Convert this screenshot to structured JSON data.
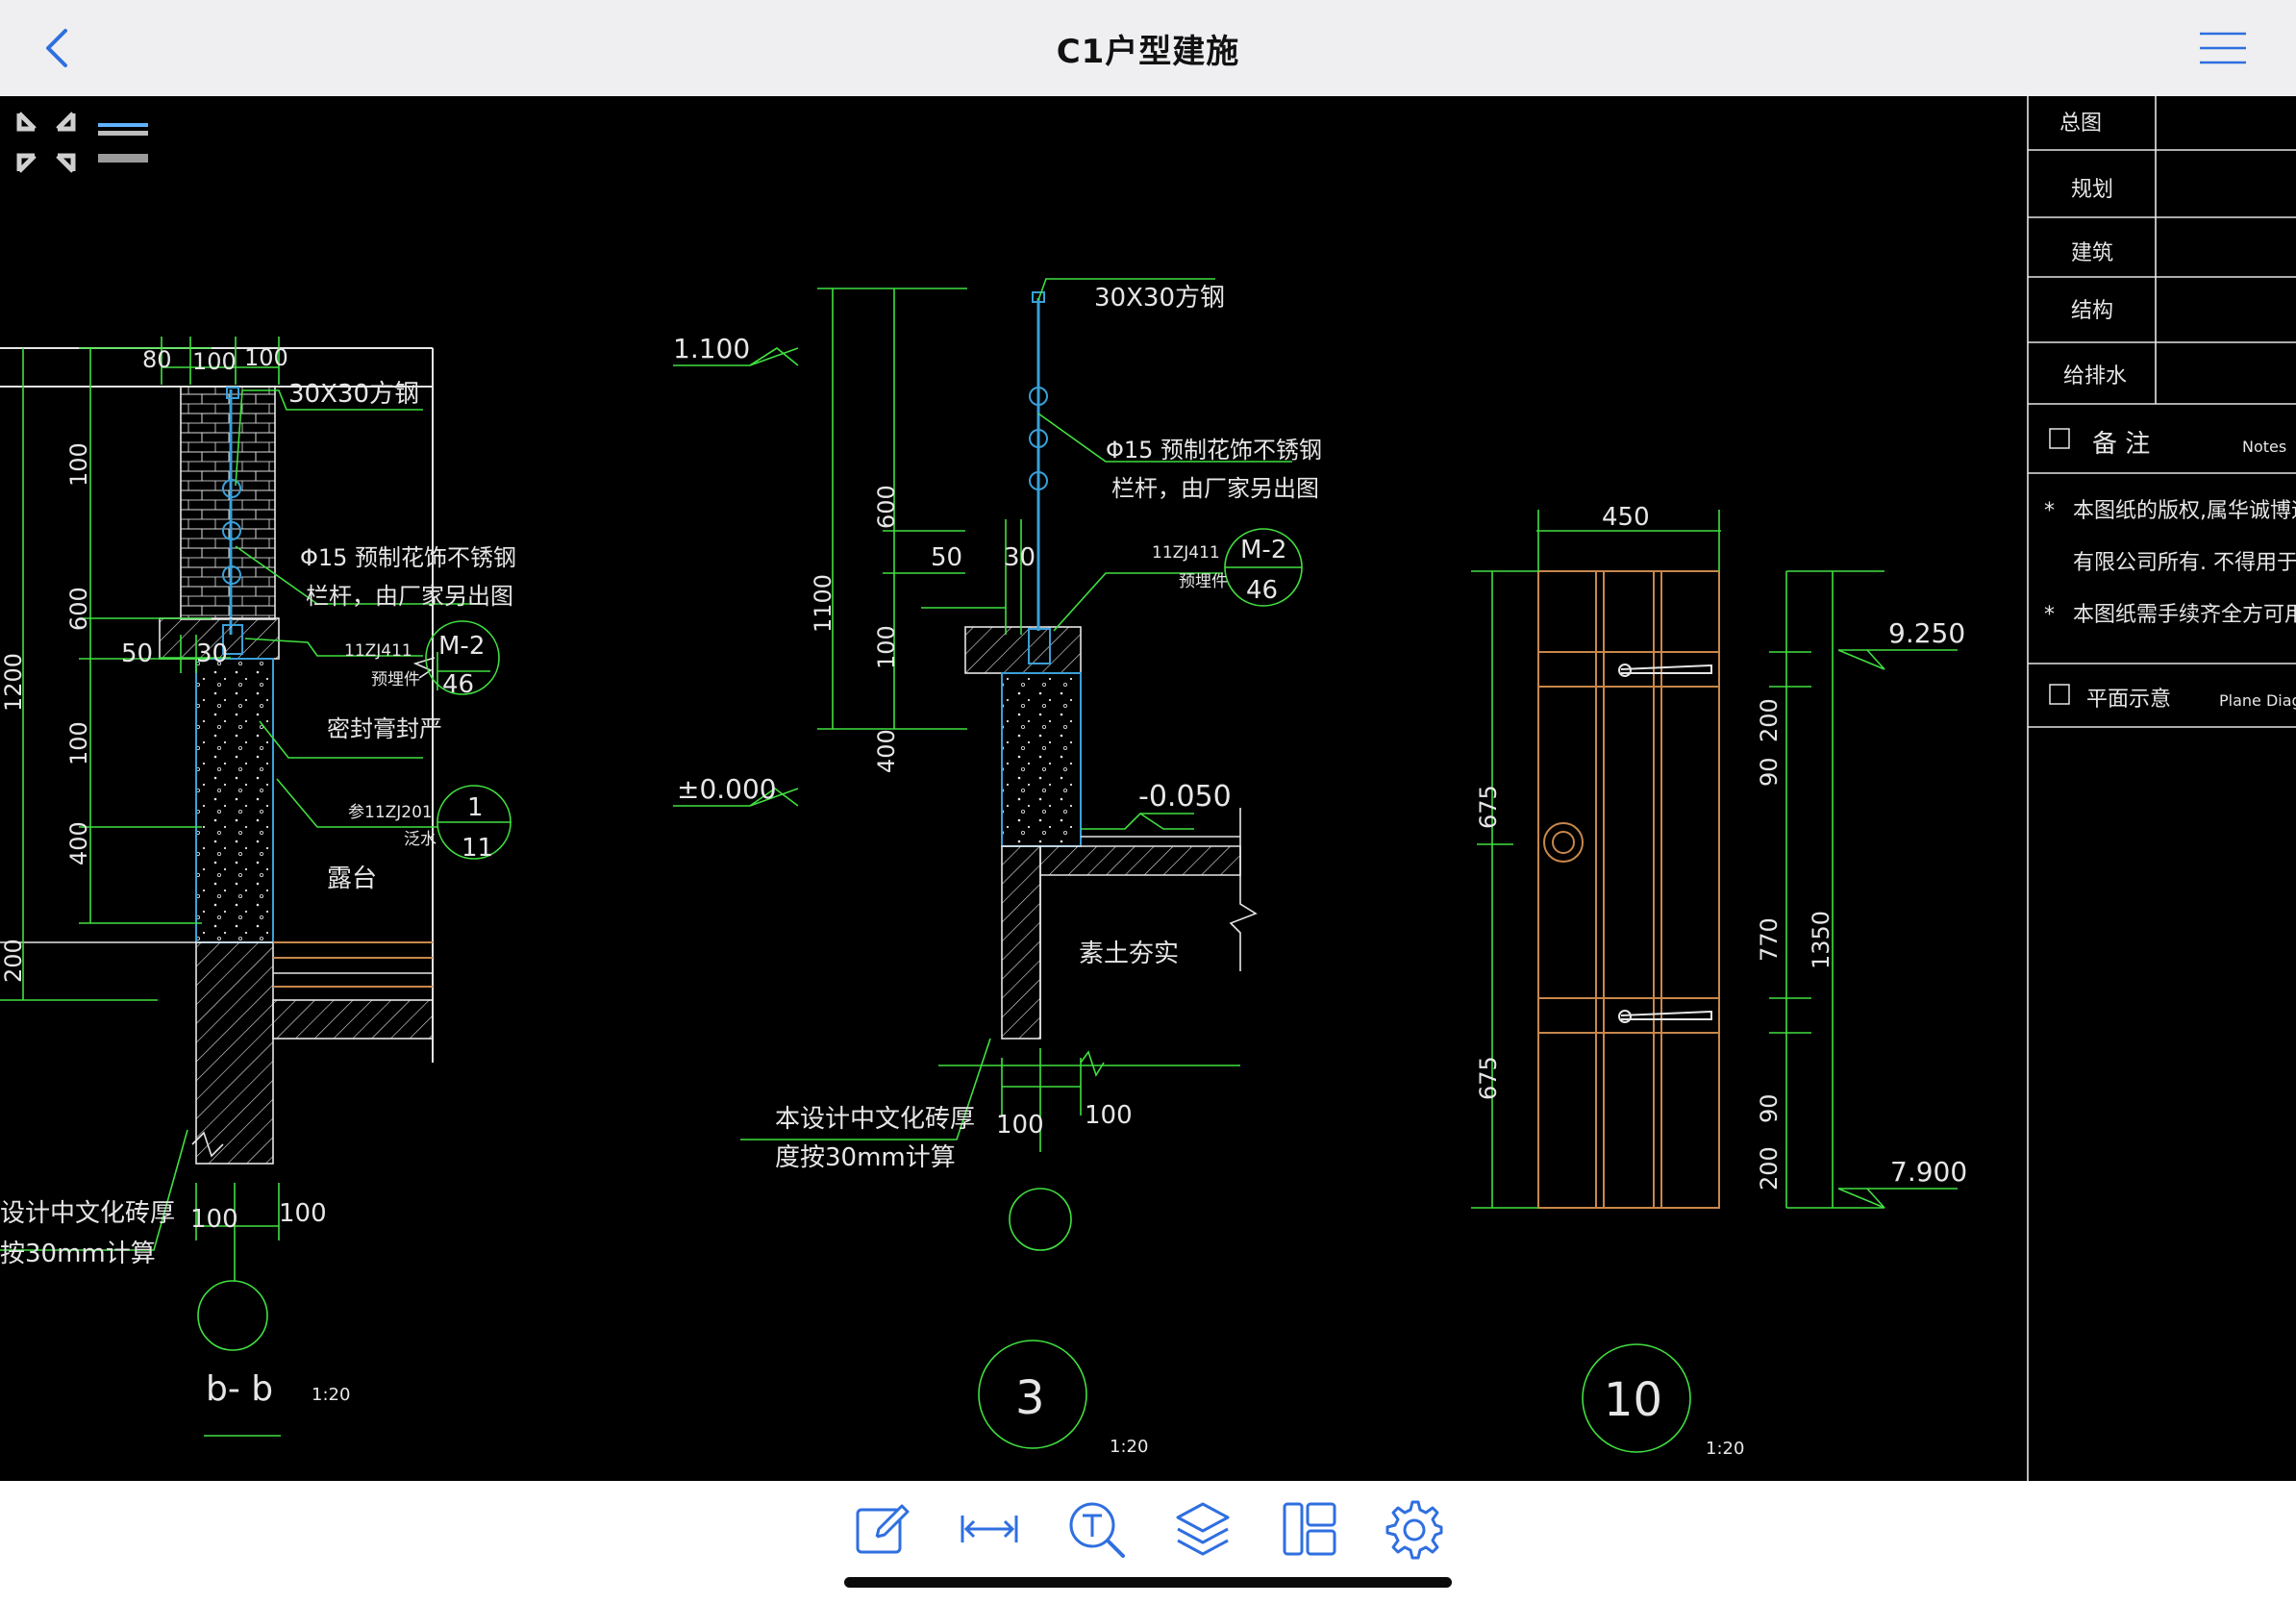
{
  "window": {
    "title": "C1户型建施"
  },
  "navbar": {
    "back_icon": "chevron-left-icon",
    "menu_icon": "hamburger-menu-icon"
  },
  "colors": {
    "accent": "#2f6fe0",
    "canvas_bg": "#000000",
    "line_green": "#40e040",
    "line_white": "#e6e6e6",
    "hatch_blue": "#3aa0d8",
    "door_orange": "#c8874a"
  },
  "viewer_controls": {
    "fit_icon": "fit-screen-icon",
    "layers_toggle_icon": "layer-bars-icon"
  },
  "drawing": {
    "section_bb": {
      "dims_top": [
        "80",
        "100",
        "100"
      ],
      "dims_vertical": [
        "100",
        "600",
        "100",
        "400",
        "200"
      ],
      "dim_total": "1200",
      "dims_left": [
        "50",
        "30"
      ],
      "label_steel": "30X30方钢",
      "label_rail": [
        "Φ15 预制花饰不锈钢",
        "栏杆，由厂家另出图"
      ],
      "ref_code": "11ZJ411",
      "ref_sub": "预埋件",
      "ref_top": "M-2",
      "ref_bottom": "46",
      "label_seal": "密封膏封严",
      "ref2_code": "参11ZJ201",
      "ref2_sub": "泛水",
      "ref2_top": "1",
      "ref2_bottom": "11",
      "label_area": "露台",
      "note": [
        "设计中文化砖厚",
        "按30mm计算"
      ],
      "dims_bottom": [
        "100",
        "100"
      ],
      "name": "b- b",
      "scale": "1:20"
    },
    "section_3": {
      "level_top": "1.100",
      "level_zero": "±0.000",
      "level_floor": "-0.050",
      "label_steel": "30X30方钢",
      "label_rail": [
        "Φ15 预制花饰不锈钢",
        "栏杆，由厂家另出图"
      ],
      "ref_code": "11ZJ411",
      "ref_sub": "预埋件",
      "ref_top": "M-2",
      "ref_bottom": "46",
      "dims_vertical": [
        "600",
        "100",
        "400"
      ],
      "dim_total": "1100",
      "dims_left": [
        "50",
        "30"
      ],
      "label_soil": "素土夯实",
      "note": [
        "本设计中文化砖厚",
        "度按30mm计算"
      ],
      "dims_bottom": [
        "100",
        "100"
      ],
      "name": "3",
      "scale": "1:20"
    },
    "detail_10": {
      "width": "450",
      "level_top": "9.250",
      "level_bottom": "7.900",
      "dims_left": [
        "675",
        "675"
      ],
      "dims_right": [
        "200",
        "90",
        "770",
        "90",
        "200"
      ],
      "dim_total": "1350",
      "name": "10",
      "scale": "1:20"
    },
    "title_block": {
      "rows": [
        "总图",
        "规划",
        "建筑",
        "结构",
        "给排水"
      ],
      "notes_title": "备 注",
      "notes_en": "Notes",
      "notes": [
        "本图纸的版权,属华诚博远(北京",
        "有限公司所有.    不得用于",
        "本图纸需手续齐全方可用于施工"
      ],
      "plane_title": "平面示意",
      "plane_en": "Plane Diag"
    }
  },
  "toolbar": {
    "items": [
      {
        "name": "annotate-tool",
        "icon": "pencil-edit-icon"
      },
      {
        "name": "measure-tool",
        "icon": "measure-distance-icon"
      },
      {
        "name": "text-search-tool",
        "icon": "text-search-icon"
      },
      {
        "name": "layers-tool",
        "icon": "layers-icon"
      },
      {
        "name": "layout-tool",
        "icon": "layout-panels-icon"
      },
      {
        "name": "settings-tool",
        "icon": "gear-icon"
      }
    ]
  }
}
